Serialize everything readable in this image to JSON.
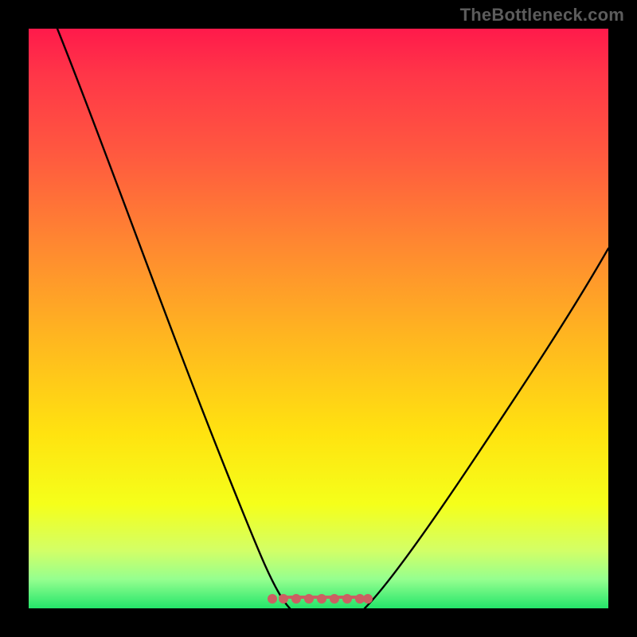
{
  "watermark": "TheBottleneck.com",
  "colors": {
    "background": "#000000",
    "gradient_top": "#ff1a4b",
    "gradient_bottom": "#24e56a",
    "curve": "#000000",
    "marker": "#cb6062",
    "watermark_text": "#5c5c5c"
  },
  "chart_data": {
    "type": "line",
    "title": "",
    "xlabel": "",
    "ylabel": "",
    "xlim": [
      0,
      100
    ],
    "ylim": [
      0,
      100
    ],
    "grid": false,
    "series": [
      {
        "name": "left-curve",
        "x": [
          5,
          10,
          15,
          20,
          25,
          30,
          35,
          40,
          43,
          45
        ],
        "values": [
          100,
          90,
          78,
          64,
          50,
          36,
          24,
          12,
          4,
          0
        ]
      },
      {
        "name": "right-curve",
        "x": [
          58,
          60,
          65,
          70,
          75,
          80,
          85,
          90,
          95,
          100
        ],
        "values": [
          0,
          3,
          9,
          16,
          24,
          32,
          41,
          50,
          57,
          62
        ]
      }
    ],
    "annotation": {
      "name": "low-plateau",
      "type": "range-x",
      "x_start": 43,
      "x_end": 58,
      "y": 0
    }
  }
}
